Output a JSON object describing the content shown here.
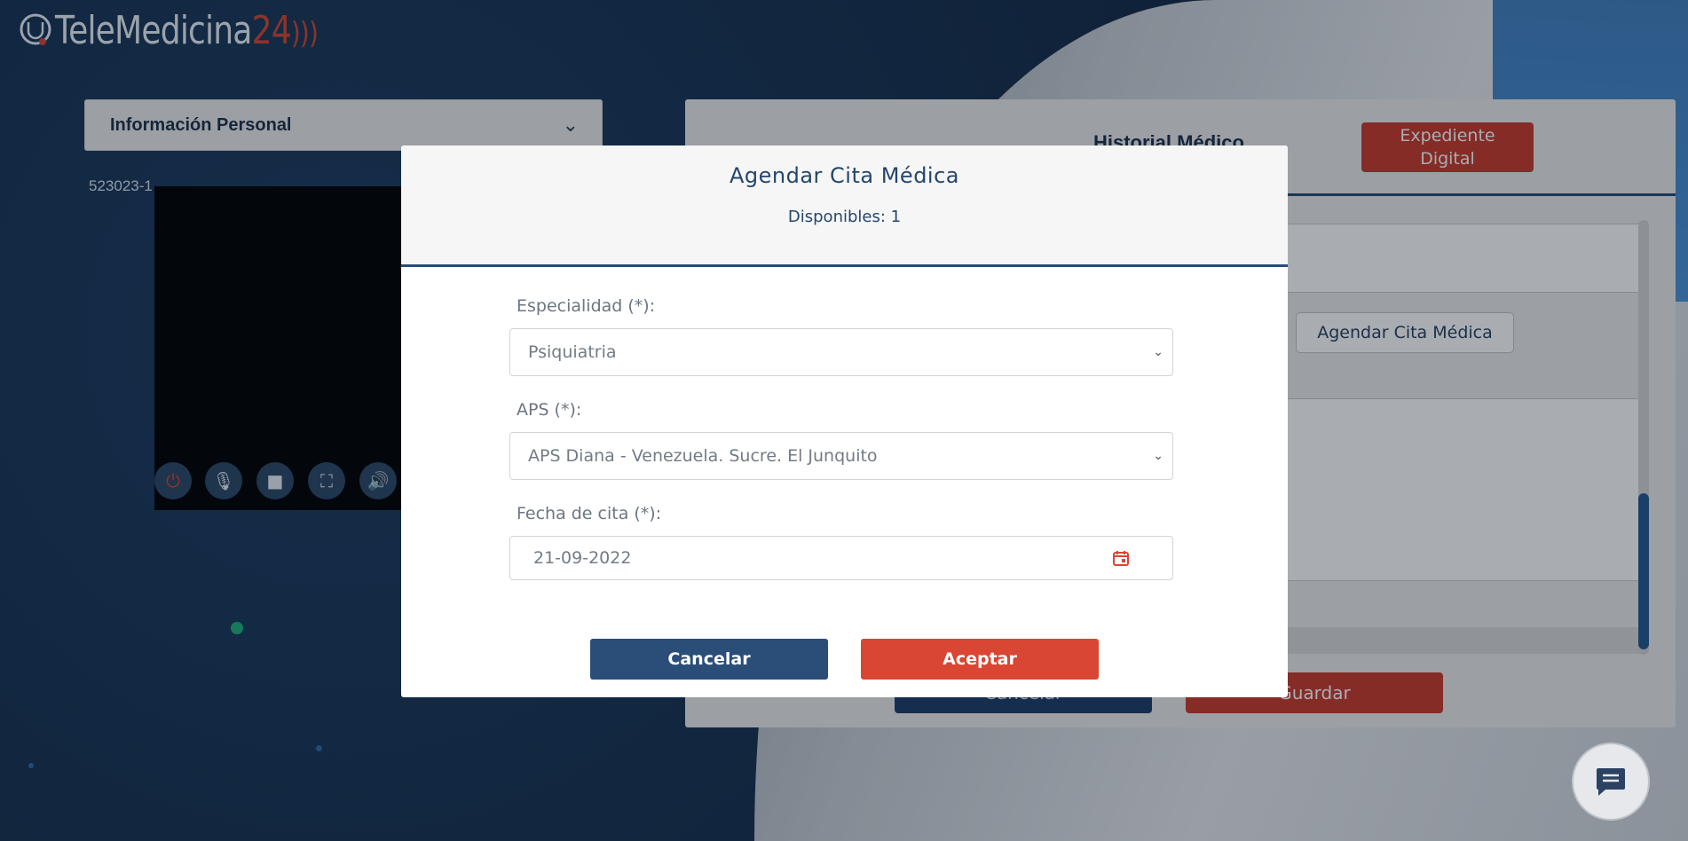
{
  "logo": {
    "brand": "TeleMedicina",
    "number": "24"
  },
  "personal_info": {
    "label": "Información Personal"
  },
  "patient_id": "523023-1",
  "record": {
    "title": "Historial Médico",
    "expediente_line1": "Expediente",
    "expediente_line2": "Digital",
    "schedule_button": "Agendar Cita Médica",
    "cancel_label": "Cancelar",
    "save_label": "Guardar"
  },
  "modal": {
    "title": "Agendar Cita Médica",
    "available": "Disponibles: 1",
    "specialty_label": "Especialidad (*):",
    "specialty_value": "Psiquiatria",
    "aps_label": "APS (*):",
    "aps_value": "APS Diana - Venezuela. Sucre. El Junquito",
    "date_label": "Fecha de cita (*):",
    "date_value": "21-09-2022",
    "cancel": "Cancelar",
    "accept": "Aceptar"
  },
  "colors": {
    "primary_navy": "#2b4e78",
    "accent_red": "#d94633"
  }
}
